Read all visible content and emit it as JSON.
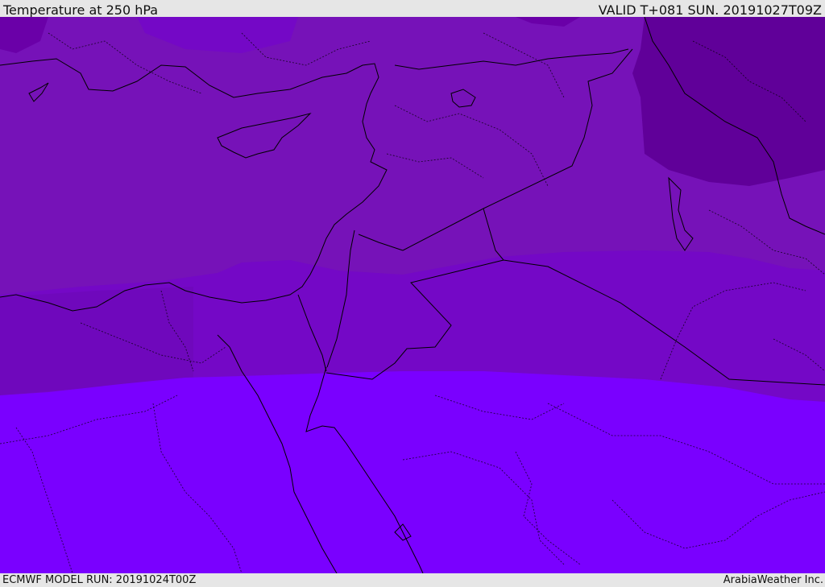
{
  "header": {
    "title": "Temperature at 250 hPa",
    "valid_time": "VALID T+081 SUN. 20191027T09Z"
  },
  "footer": {
    "model_run": "ECMWF MODEL RUN: 20191024T00Z",
    "credit": "ArabiaWeather Inc."
  },
  "colors": {
    "band_darkest": "#600099",
    "band_dark": "#6a00a8",
    "band_mid": "#7612b8",
    "band_mid2": "#7408c6",
    "band_light": "#7a00ff",
    "border": "#000000"
  }
}
